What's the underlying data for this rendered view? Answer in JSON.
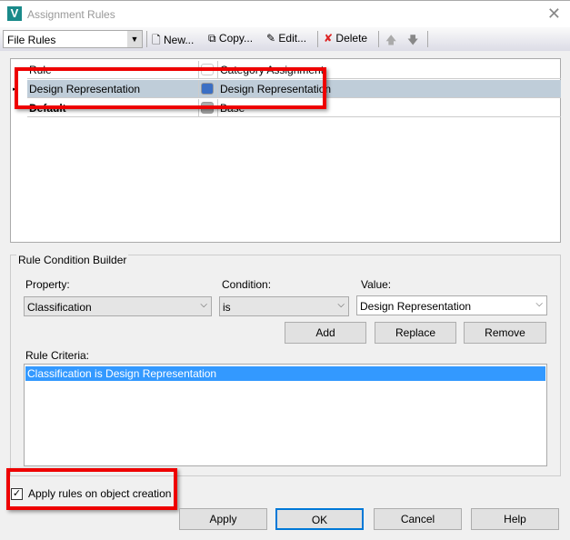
{
  "window": {
    "title": "Assignment Rules",
    "logo": "V"
  },
  "toolbar": {
    "rules_select": "File Rules",
    "new": "New...",
    "copy": "Copy...",
    "edit": "Edit...",
    "delete": "Delete"
  },
  "grid": {
    "headers": [
      "Rule",
      "Category Assignment"
    ],
    "rows": [
      {
        "rule": "Design Representation",
        "category": "Design Representation",
        "color": "#3b6fc4"
      },
      {
        "rule": "Default",
        "category": "Base",
        "color": "#aaaaaa"
      }
    ]
  },
  "builder": {
    "title": "Rule Condition Builder",
    "property_label": "Property:",
    "property_value": "Classification",
    "condition_label": "Condition:",
    "condition_value": "is",
    "value_label": "Value:",
    "value_value": "Design Representation",
    "add": "Add",
    "replace": "Replace",
    "remove": "Remove",
    "criteria_label": "Rule Criteria:",
    "criteria": [
      "Classification is Design Representation"
    ]
  },
  "apply_on_creation": {
    "label": "Apply rules on object creation",
    "checked": true
  },
  "buttons": {
    "apply": "Apply",
    "ok": "OK",
    "cancel": "Cancel",
    "help": "Help"
  }
}
